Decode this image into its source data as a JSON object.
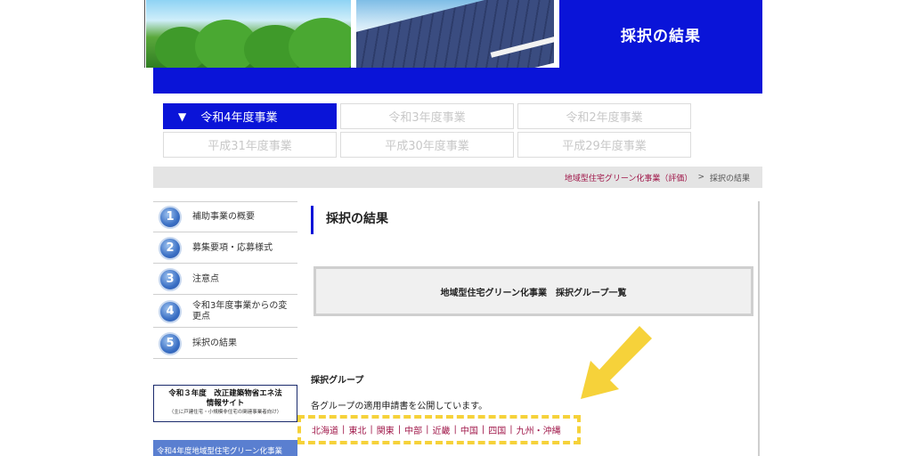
{
  "header": {
    "title": "採択の結果"
  },
  "year_tabs": [
    {
      "label": "令和4年度事業",
      "active": true
    },
    {
      "label": "令和3年度事業",
      "active": false
    },
    {
      "label": "令和2年度事業",
      "active": false
    },
    {
      "label": "平成31年度事業",
      "active": false
    },
    {
      "label": "平成30年度事業",
      "active": false
    },
    {
      "label": "平成29年度事業",
      "active": false
    }
  ],
  "active_tab_arrow": "▼",
  "breadcrumb": {
    "link": "地域型住宅グリーン化事業（評価）",
    "separator": ">",
    "current": "採択の結果"
  },
  "sidebar": {
    "items": [
      {
        "number": "1",
        "label": "補助事業の概要"
      },
      {
        "number": "2",
        "label": "募集要項・応募様式"
      },
      {
        "number": "3",
        "label": "注意点"
      },
      {
        "number": "4",
        "label": "令和3年度事業からの変更点"
      },
      {
        "number": "5",
        "label": "採択の結果"
      }
    ],
    "banner_title_line1": "令和３年度　改正建築物省エネ法",
    "banner_title_line2": "情報サイト",
    "banner_subtitle": "（主に戸建住宅・小規模非住宅の関連事業者向け）",
    "banner2_label": "令和4年度地域型住宅グリーン化事業"
  },
  "main": {
    "heading": "採択の結果",
    "group_button": "地域型住宅グリーン化事業　採択グループ一覧",
    "section_label": "採択グループ",
    "description": "各グループの適用申請書を公開しています。",
    "regions": [
      "北海道",
      "東北",
      "関東",
      "中部",
      "近畿",
      "中国",
      "四国",
      "九州・沖縄"
    ],
    "region_separator": "|"
  },
  "colors": {
    "brand_blue": "#0a14d8",
    "link_red": "#a0184a",
    "highlight_yellow": "#f6d23a"
  }
}
